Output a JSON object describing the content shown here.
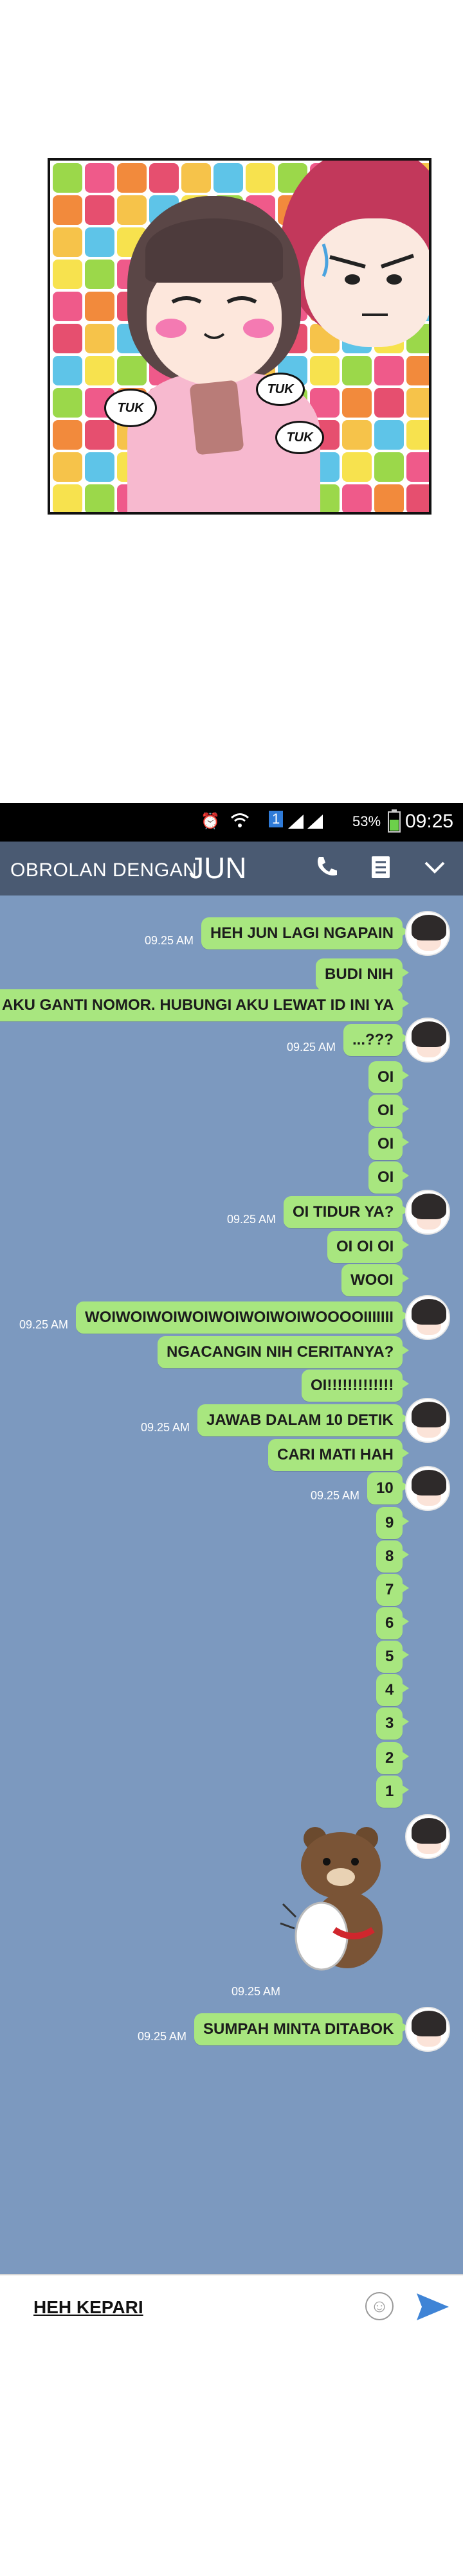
{
  "comic": {
    "sfx": [
      "TUK",
      "TUK",
      "TUK"
    ]
  },
  "status_bar": {
    "sim": "1",
    "battery": "53%",
    "time": "09:25"
  },
  "header": {
    "title": "OBROLAN DENGAN",
    "name": "JUN",
    "icons": [
      "phone-icon",
      "notes-icon",
      "chevron-down-icon"
    ]
  },
  "messages": [
    {
      "text": "HEH JUN LAGI NGAPAIN",
      "time": "09.25 AM"
    },
    {
      "text": "BUDI NIH",
      "time": ""
    },
    {
      "text": "AKU GANTI NOMOR. HUBUNGI AKU LEWAT ID INI YA",
      "time": ""
    },
    {
      "text": "...???",
      "time": "09.25 AM"
    },
    {
      "text": "OI",
      "time": ""
    },
    {
      "text": "OI",
      "time": ""
    },
    {
      "text": "OI",
      "time": ""
    },
    {
      "text": "OI",
      "time": ""
    },
    {
      "text": "OI TIDUR YA?",
      "time": "09.25 AM"
    },
    {
      "text": "OI OI OI",
      "time": ""
    },
    {
      "text": "WOOI",
      "time": ""
    },
    {
      "text": "WOIWOIWOIWOIWOIWOIWOIWOOOOIIIIIII",
      "time": "09.25 AM"
    },
    {
      "text": "NGACANGIN NIH CERITANYA?",
      "time": ""
    },
    {
      "text": "OI!!!!!!!!!!!!!",
      "time": ""
    },
    {
      "text": "JAWAB DALAM 10 DETIK",
      "time": "09.25 AM"
    },
    {
      "text": "CARI MATI HAH",
      "time": ""
    },
    {
      "text": "10",
      "time": "09.25 AM"
    },
    {
      "text": "9",
      "time": ""
    },
    {
      "text": "8",
      "time": ""
    },
    {
      "text": "7",
      "time": ""
    },
    {
      "text": "6",
      "time": ""
    },
    {
      "text": "5",
      "time": ""
    },
    {
      "text": "4",
      "time": ""
    },
    {
      "text": "3",
      "time": ""
    },
    {
      "text": "2",
      "time": ""
    },
    {
      "text": "1",
      "time": ""
    }
  ],
  "sticker": {
    "time": "09.25 AM",
    "icon": "bear-sticker-icon"
  },
  "last_message": {
    "text": "SUMPAH MINTA DITABOK",
    "time": "09.25 AM"
  },
  "input": {
    "value": "HEH KEPARI"
  }
}
